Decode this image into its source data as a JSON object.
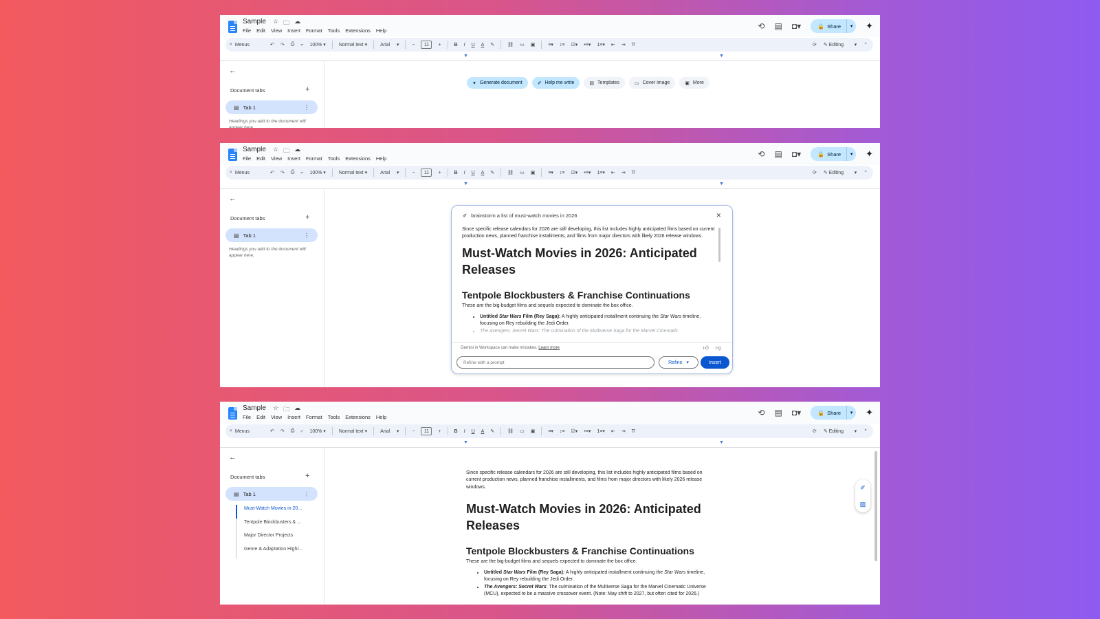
{
  "app": {
    "doc_title": "Sample",
    "menu": [
      "File",
      "Edit",
      "View",
      "Insert",
      "Format",
      "Tools",
      "Extensions",
      "Help"
    ],
    "share_label": "Share"
  },
  "toolbar": {
    "menus_label": "Menus",
    "zoom": "100%",
    "style": "Normal text",
    "font": "Arial",
    "font_size": "11",
    "mode": "Editing"
  },
  "sidebar": {
    "tabs_label": "Document tabs",
    "tab1_label": "Tab 1",
    "hint": "Headings you add to the document will appear here.",
    "outline": [
      "Must-Watch Movies in 20...",
      "Tentpole Blockbusters & ...",
      "Major Director Projects",
      "Genre & Adaptation Highl..."
    ]
  },
  "chips": {
    "generate": "Generate document",
    "help_write": "Help me write",
    "templates": "Templates",
    "cover": "Cover image",
    "more": "More"
  },
  "dialog": {
    "prompt": "brainstorm a list of must-watch movies in 2026",
    "disclaimer": "Gemini in Workspace can make mistakes.",
    "learn_more": "Learn more",
    "refine_placeholder": "Refine with a prompt",
    "refine_label": "Refine",
    "insert_label": "Insert"
  },
  "doc": {
    "intro": "Since specific release calendars for 2026 are still developing, this list includes highly anticipated films based on current production news, planned franchise installments, and films from major directors with likely 2026 release windows.",
    "h1": "Must-Watch Movies in 2026: Anticipated Releases",
    "h2": "Tentpole Blockbusters & Franchise Continuations",
    "h2_sub": "These are the big-budget films and sequels expected to dominate the box office.",
    "b1_title_pre": "Untitled ",
    "b1_title_em": "Star Wars",
    "b1_title_post": " Film (Rey Saga):",
    "b1_text_pre": " A highly anticipated installment continuing the ",
    "b1_text_em": "Star Wars",
    "b1_text_post": " timeline, focusing on Rey rebuilding the Jedi Order.",
    "b2_title": "The Avengers: Secret Wars",
    "b2_text": ": The culmination of the Multiverse Saga for the Marvel Cinematic Universe (MCU), expected to be a massive crossover event. (Note: May shift to 2027, but often cited for 2026.)",
    "b2_faded": "The Avengers: Secret Wars: The culmination of the Multiverse Saga for the Marvel Cinematic"
  }
}
